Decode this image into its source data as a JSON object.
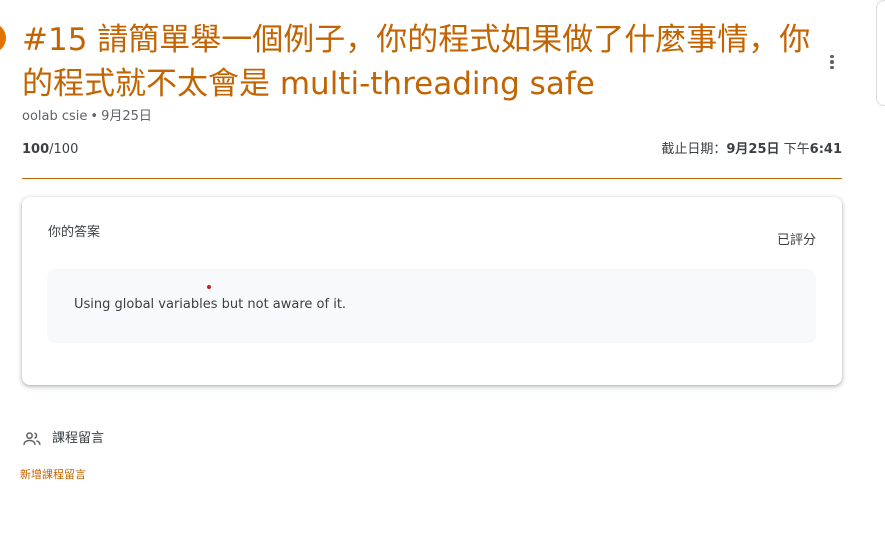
{
  "assignment": {
    "title": "#15 請簡單舉一個例子，你的程式如果做了什麼事情，你的程式就不太會是 multi-threading safe",
    "author": "oolab csie",
    "meta_separator": "•",
    "posted_date": "9月25日",
    "score_earned": "100",
    "score_total": "/100",
    "due_label": "截止日期：",
    "due_date": "9月25日",
    "due_time_prefix": "下午",
    "due_time": "6:41"
  },
  "submission": {
    "heading": "你的答案",
    "status": "已評分",
    "answer": "Using global variables but not aware of it."
  },
  "comments": {
    "title": "課程留言",
    "add_link": "新增課程留言"
  },
  "colors": {
    "accent": "#c26401",
    "icon_orange": "#e37400",
    "text": "#3c4043",
    "muted": "#5f6368",
    "answer_bg": "#f8f9fa"
  },
  "icons": {
    "menu": "more-vert-icon",
    "people": "people-icon",
    "assignment": "assignment-icon"
  }
}
